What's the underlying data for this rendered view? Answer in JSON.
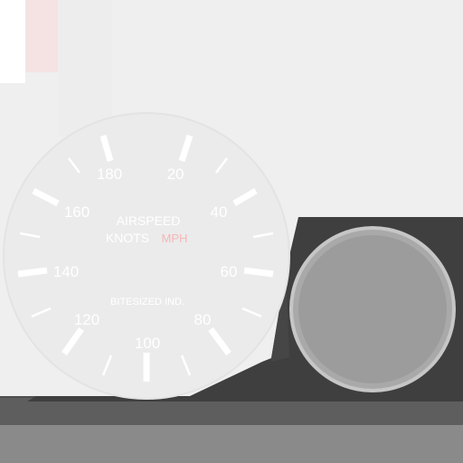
{
  "gauge": {
    "title_line1": "AIRSPEED",
    "title_line2": "KNOTS",
    "title_unit_extra": "MPH",
    "maker": "BITESIZED IND.",
    "labels": [
      "20",
      "40",
      "60",
      "80",
      "100",
      "120",
      "140",
      "160",
      "180"
    ]
  },
  "colors": {
    "background": "#efefef",
    "gauge_face": "#ebebeb",
    "tick": "#ffffff",
    "accent": "#ff8a8a",
    "housing": "#3f3f3f",
    "knob": "#9c9c9c"
  },
  "icons": {
    "knob": "round-knob-icon"
  }
}
